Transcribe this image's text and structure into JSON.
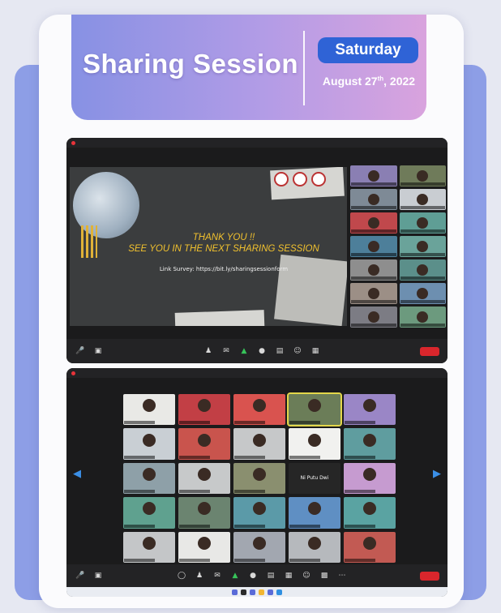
{
  "banner": {
    "title": "Sharing Session",
    "day": "Saturday",
    "date_main": "August 27",
    "date_suffix": "th",
    "date_year": ", 2022"
  },
  "slide": {
    "line1": "THANK YOU !!",
    "line2": "SEE YOU IN THE NEXT SHARING SESSION",
    "survey": "Link Survey: https://bit.ly/sharingsessionform"
  },
  "gallery": {
    "featured_tile_name": "Ni Putu Dwi"
  },
  "colors": {
    "banner_start": "#8791e4",
    "banner_end": "#d9a3de",
    "day_pill": "#2f63d6",
    "slide_text": "#f1c12e",
    "end_button": "#d9262c",
    "active_speaker": "#e3d64a"
  },
  "icons": [
    "mute-icon",
    "video-icon",
    "participants-icon",
    "chat-icon",
    "share-screen-icon",
    "record-icon",
    "reactions-icon",
    "apps-icon",
    "windows-start-icon",
    "search-icon"
  ]
}
